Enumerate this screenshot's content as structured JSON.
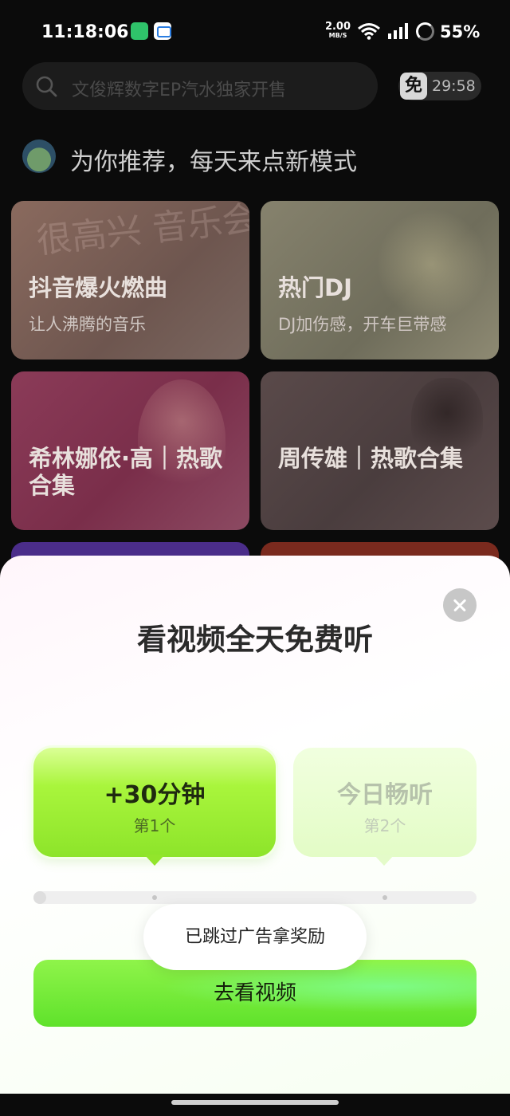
{
  "status_bar": {
    "time": "11:18:06",
    "net_speed_value": "2.00",
    "net_speed_unit": "MB/S",
    "battery": "55%"
  },
  "search": {
    "placeholder": "文俊辉数字EP汽水独家开售"
  },
  "free_badge": {
    "icon_text": "免",
    "time": "29:58"
  },
  "recommend": {
    "title": "为你推荐，每天来点新模式"
  },
  "cards": [
    {
      "title": "抖音爆火燃曲",
      "subtitle": "让人沸腾的音乐",
      "deco": "很高兴 音乐会"
    },
    {
      "title": "热门DJ",
      "subtitle": "DJ加伤感，开车巨带感"
    },
    {
      "title": "希林娜依·高｜热歌合集",
      "subtitle": ""
    },
    {
      "title": "周传雄｜热歌合集",
      "subtitle": ""
    }
  ],
  "sheet": {
    "title": "看视频全天免费听",
    "options": [
      {
        "label": "+30分钟",
        "sub": "第1个",
        "state": "active"
      },
      {
        "label": "今日畅听",
        "sub": "第2个",
        "state": "locked"
      }
    ],
    "progress": 0.0,
    "toast": "已跳过广告拿奖励",
    "cta": "去看视频"
  },
  "colors": {
    "cta_green": "#6ee832",
    "option_active": "#a9f53c",
    "background": "#0b0b0b"
  }
}
